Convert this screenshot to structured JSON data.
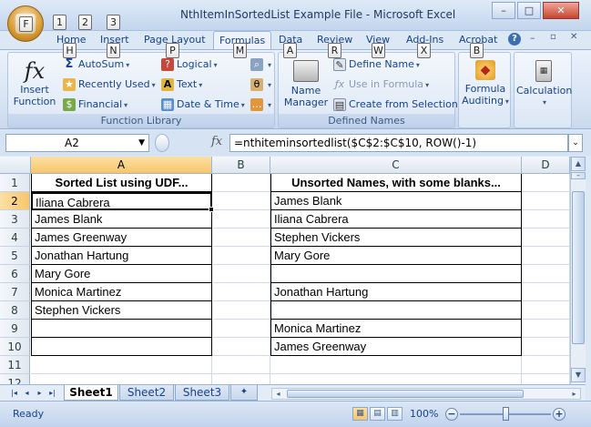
{
  "window": {
    "title": "NthItemInSortedList Example File - Microsoft Excel",
    "office_keytip": "F",
    "minimize": "–",
    "maximize": "□",
    "close": "✕"
  },
  "quick_access_keytips": [
    "1",
    "2",
    "3"
  ],
  "tabs": [
    {
      "label": "Home",
      "keytip": "H"
    },
    {
      "label": "Insert",
      "keytip": "N"
    },
    {
      "label": "Page Layout",
      "keytip": "P"
    },
    {
      "label": "Formulas",
      "keytip": "M"
    },
    {
      "label": "Data",
      "keytip": "A"
    },
    {
      "label": "Review",
      "keytip": "R"
    },
    {
      "label": "View",
      "keytip": "W"
    },
    {
      "label": "Add-Ins",
      "keytip": "X"
    },
    {
      "label": "Acrobat",
      "keytip": "B"
    }
  ],
  "ribbon": {
    "insert_function": {
      "line1": "Insert",
      "line2": "Function",
      "icon": "fx-icon"
    },
    "function_library": {
      "label": "Function Library",
      "autosum": "AutoSum",
      "recently_used": "Recently Used",
      "financial": "Financial",
      "logical": "Logical",
      "text": "Text",
      "date_time": "Date & Time"
    },
    "defined_names": {
      "label": "Defined Names",
      "name_manager_1": "Name",
      "name_manager_2": "Manager",
      "define_name": "Define Name",
      "use_in_formula": "Use in Formula",
      "create_from_selection": "Create from Selection"
    },
    "formula_auditing": {
      "line1": "Formula",
      "line2": "Auditing"
    },
    "calculation": {
      "line1": "Calculation"
    }
  },
  "formula_bar": {
    "name_box": "A2",
    "fx_label": "fx",
    "formula": "=nthiteminsortedlist($C$2:$C$10, ROW()-1)"
  },
  "sheet": {
    "columns": [
      "A",
      "B",
      "C",
      "D"
    ],
    "rows": [
      "1",
      "2",
      "3",
      "4",
      "5",
      "6",
      "7",
      "8",
      "9",
      "10",
      "11",
      "12"
    ],
    "col_a_header": "Sorted List using UDF...",
    "col_c_header": "Unsorted Names, with some blanks...",
    "col_a": [
      "Iliana Cabrera",
      "James Blank",
      "James Greenway",
      "Jonathan Hartung",
      "Mary Gore",
      "Monica Martinez",
      "Stephen Vickers",
      "",
      ""
    ],
    "col_c": [
      "James Blank",
      "Iliana Cabrera",
      "Stephen Vickers",
      "Mary Gore",
      "",
      "Jonathan Hartung",
      "",
      "Monica Martinez",
      "James Greenway"
    ]
  },
  "sheet_tabs": [
    "Sheet1",
    "Sheet2",
    "Sheet3"
  ],
  "status": {
    "text": "Ready",
    "zoom": "100%",
    "zoom_out": "−",
    "zoom_in": "+"
  }
}
